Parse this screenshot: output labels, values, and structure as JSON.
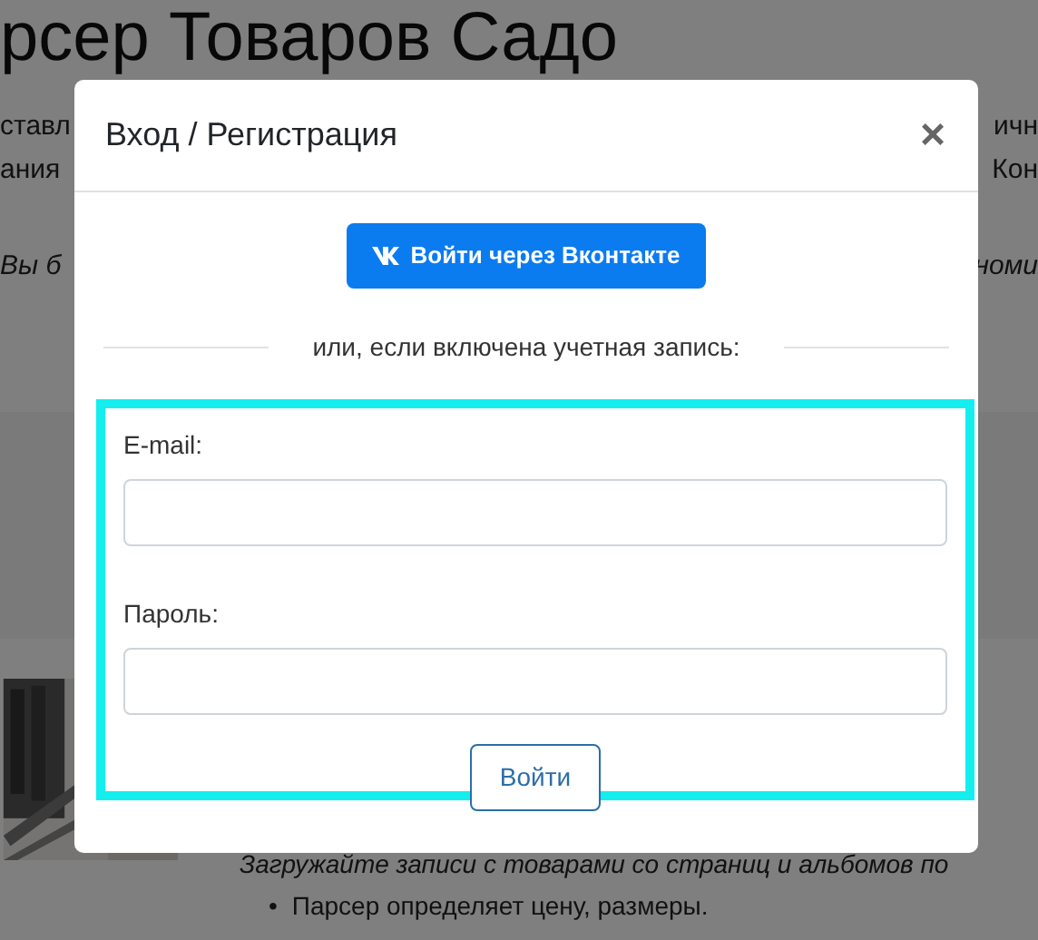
{
  "background": {
    "heading": "рсер Товаров Садо",
    "lines": [
      {
        "left": "ставл",
        "right": "ичн"
      },
      {
        "left": "ания",
        "right": "Кон"
      }
    ],
    "italic_line": {
      "left": "Вы б",
      "right": "номи"
    },
    "notice": "Загружайте записи с товарами со страниц и альбомов по",
    "bullets": [
      {
        "marker": "•",
        "text": "Парсер определяет цену, размеры."
      }
    ]
  },
  "modal": {
    "title": "Вход / Регистрация",
    "close": "×",
    "social_button": "Войти через Вконтакте",
    "divider_text": "или, если включена учетная запись:",
    "fields": [
      {
        "label": "E-mail:"
      },
      {
        "label": "Пароль:"
      }
    ],
    "submit": "Войти"
  }
}
